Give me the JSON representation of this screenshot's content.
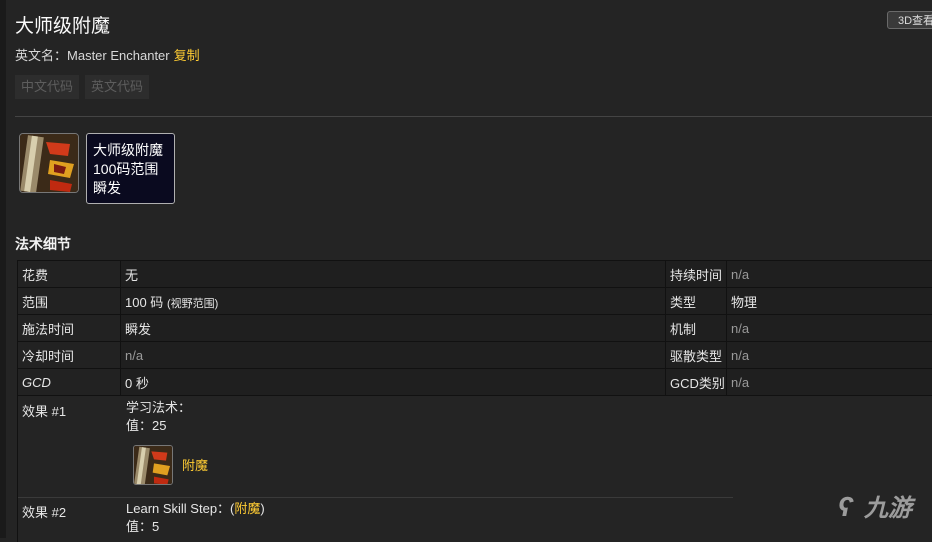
{
  "header": {
    "title": "大师级附魔",
    "btn_3d": "3D查看",
    "en_prefix": "英文名：",
    "en_name": "Master Enchanter",
    "copy_label": "复制",
    "code_cn": "中文代码",
    "code_en": "英文代码"
  },
  "spell": {
    "icon": "enchanting-rune-icon",
    "tooltip_name": "大师级附魔",
    "tooltip_range": "100码范围",
    "tooltip_cast": "瞬发"
  },
  "details": {
    "section_title": "法术细节",
    "rows": [
      {
        "label": "花费",
        "value": "无"
      },
      {
        "label": "范围",
        "value": "100 码",
        "extra": "(视野范围)"
      },
      {
        "label": "施法时间",
        "value": "瞬发"
      },
      {
        "label": "冷却时间",
        "value": "n/a"
      },
      {
        "label": "GCD",
        "value": "0 秒"
      }
    ],
    "side_rows": [
      {
        "label": "持续时间",
        "value": "n/a"
      },
      {
        "label": "类型",
        "value": "物理"
      },
      {
        "label": "机制",
        "value": "n/a"
      },
      {
        "label": "驱散类型",
        "value": "n/a"
      },
      {
        "label": "GCD类别",
        "value": "n/a"
      }
    ]
  },
  "effects": [
    {
      "label": "效果 #1",
      "line1": "学习法术：",
      "line2": "值：25",
      "link": "附魔"
    },
    {
      "label": "效果 #2",
      "line1_prefix": "Learn Skill Step：(",
      "line1_link": "附魔",
      "line1_suffix": ")",
      "line2": "值：5"
    }
  ],
  "watermark": {
    "text": "九游"
  },
  "colors": {
    "accent": "#ffcc33",
    "background": "#242424"
  }
}
